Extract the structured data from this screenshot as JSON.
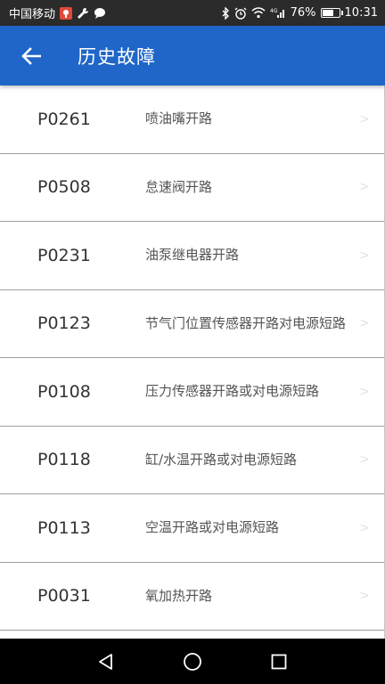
{
  "status_bar": {
    "carrier": "中国移动",
    "battery_percent": "76%",
    "battery_level": 0.76,
    "time": "10:31",
    "network": "4G"
  },
  "app_bar": {
    "title": "历史故障",
    "back_icon": "arrow-left-icon",
    "color": "#1f66c8"
  },
  "faults": [
    {
      "code": "P0261",
      "description": "喷油嘴开路"
    },
    {
      "code": "P0508",
      "description": "怠速阀开路"
    },
    {
      "code": "P0231",
      "description": "油泵继电器开路"
    },
    {
      "code": "P0123",
      "description": "节气门位置传感器开路对电源短路"
    },
    {
      "code": "P0108",
      "description": "压力传感器开路或对电源短路"
    },
    {
      "code": "P0118",
      "description": "缸/水温开路或对电源短路"
    },
    {
      "code": "P0113",
      "description": "空温开路或对电源短路"
    },
    {
      "code": "P0031",
      "description": "氧加热开路"
    }
  ],
  "nav_bar": {
    "back": "triangle-back-icon",
    "home": "circle-home-icon",
    "recents": "square-recents-icon"
  }
}
